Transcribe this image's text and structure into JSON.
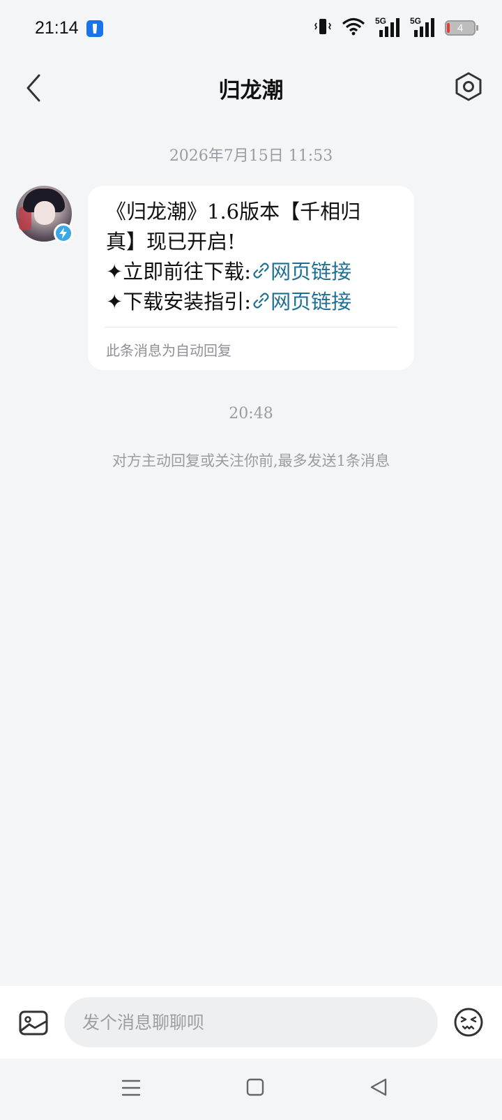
{
  "status_bar": {
    "time": "21:14",
    "network_1": "5G",
    "network_2": "5G",
    "battery_level": "4"
  },
  "header": {
    "title": "归龙潮"
  },
  "chat": {
    "first_timestamp": "2026年7月15日  11:53",
    "message": {
      "line1": "《归龙潮》1.6版本【千相归",
      "line2": "真】现已开启!",
      "line3_prefix": "✦立即前往下载:",
      "line3_link": "网页链接",
      "line4_prefix": "✦下载安装指引:",
      "line4_link": "网页链接",
      "auto_reply_note": "此条消息为自动回复"
    },
    "second_timestamp": "20:48",
    "notice": "对方主动回复或关注你前,最多发送1条消息"
  },
  "input_bar": {
    "placeholder": "发个消息聊聊呗"
  },
  "colors": {
    "background": "#f4f5f7",
    "link": "#1e6f93",
    "badge": "#3aa8e8"
  }
}
